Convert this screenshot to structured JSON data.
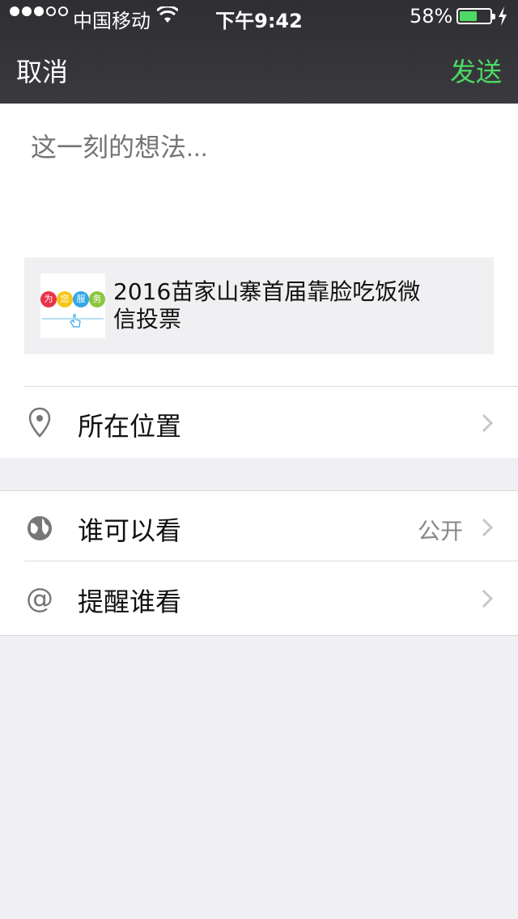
{
  "status_bar": {
    "carrier": "中国移动",
    "time": "下午9:42",
    "battery_percent": "58%",
    "battery_level": 0.58,
    "signal_bars": 3,
    "signal_total": 5
  },
  "nav": {
    "cancel_label": "取消",
    "send_label": "发送",
    "send_color": "#4cd964"
  },
  "compose": {
    "placeholder": "这一刻的想法...",
    "link_title": "2016苗家山寨首届靠脸吃饭微信投票",
    "thumbnail_text": {
      "bubbles": [
        "为",
        "您",
        "服",
        "务"
      ],
      "bubble_colors": [
        "#e8334a",
        "#f5c518",
        "#33a7e8",
        "#8cc63e"
      ]
    }
  },
  "rows": {
    "location": {
      "label": "所在位置",
      "icon": "location-pin-icon"
    },
    "visibility": {
      "label": "谁可以看",
      "value": "公开",
      "icon": "globe-icon"
    },
    "mention": {
      "label": "提醒谁看",
      "icon": "at-icon"
    }
  }
}
